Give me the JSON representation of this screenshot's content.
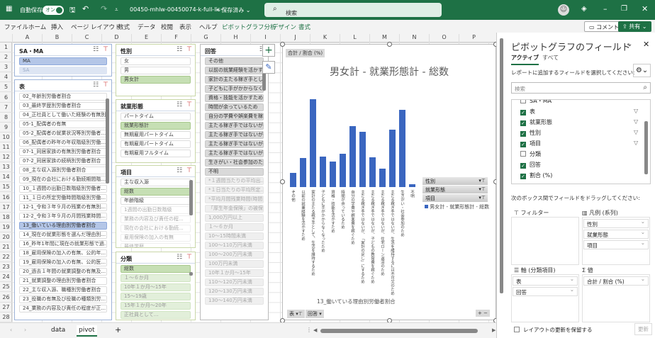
{
  "titlebar": {
    "autosave_label": "自動保存",
    "autosave_state": "オン",
    "filename": "00450-mhlw-00450074-k-full-lis···",
    "save_status": "• 保存済み ⌄",
    "search_placeholder": "検索"
  },
  "ribbon": {
    "tabs": [
      "ファイル",
      "ホーム",
      "挿入",
      "ページ レイアウト",
      "数式",
      "データ",
      "校閲",
      "表示",
      "ヘルプ",
      "ピボットグラフ分析",
      "デザイン",
      "書式"
    ],
    "comment_label": "コメント",
    "share_label": "共有"
  },
  "columns": [
    "A",
    "B",
    "C",
    "D",
    "E",
    "F",
    "G",
    "H",
    "I",
    "J",
    "K",
    "L",
    "M",
    "N",
    "O",
    "P"
  ],
  "rows": [
    "1",
    "2",
    "3",
    "4",
    "5",
    "6",
    "7",
    "8",
    "9",
    "10",
    "11",
    "12",
    "13",
    "14",
    "15",
    "16",
    "17",
    "18",
    "19",
    "20",
    "21",
    "22",
    "23",
    "24",
    "25",
    "26",
    "27",
    "28"
  ],
  "slicers": {
    "sama": {
      "title": "SA・MA",
      "items": [
        {
          "label": "MA",
          "state": "sel"
        },
        {
          "label": "SA",
          "state": "dim"
        }
      ]
    },
    "hyo": {
      "title": "表",
      "items": [
        {
          "label": "02_年齢別労働者割合",
          "state": ""
        },
        {
          "label": "03_最終学歴別労働者割合",
          "state": ""
        },
        {
          "label": "04_正社員として働いた経験の有無別...",
          "state": ""
        },
        {
          "label": "05-1_配偶者の有無",
          "state": ""
        },
        {
          "label": "05-2_配偶者の就業状況等別労働者...",
          "state": ""
        },
        {
          "label": "06_配偶者の昨年の年収階級別労働...",
          "state": ""
        },
        {
          "label": "07-1_同居家族の有無別労働者割合",
          "state": ""
        },
        {
          "label": "07-2_同居家族の続柄別労働者割合",
          "state": ""
        },
        {
          "label": "08_主な収入源別労働者割合",
          "state": ""
        },
        {
          "label": "09_現在の会社における勤続期間階...",
          "state": ""
        },
        {
          "label": "10_１週間の出勤日数階級別労働者...",
          "state": ""
        },
        {
          "label": "11_１日の所定労働時間階級別労働...",
          "state": ""
        },
        {
          "label": "12-1_令和３年９月の残業の有無別...",
          "state": ""
        },
        {
          "label": "12-2_令和３年９月の月間残業時間...",
          "state": ""
        },
        {
          "label": "13_働いている理由別労働者割合",
          "state": "sel"
        },
        {
          "label": "14_現在の就業形態を選んだ理由別...",
          "state": ""
        },
        {
          "label": "16_昨年1年間に現在の就業形態で過...",
          "state": ""
        },
        {
          "label": "18_雇用保険の加入の有無、公的年...",
          "state": ""
        },
        {
          "label": "19_雇用保険の加入の有無、公的医...",
          "state": ""
        },
        {
          "label": "20_過去１年間の就業調整の有無及...",
          "state": ""
        },
        {
          "label": "21_就業調整の理由別労働者割合",
          "state": ""
        },
        {
          "label": "22_主な収入源、職種別労働者割合",
          "state": ""
        },
        {
          "label": "23_役職の有無及び役職の種類別労...",
          "state": ""
        },
        {
          "label": "24_業務の内容及び責任の程度が正...",
          "state": ""
        }
      ]
    },
    "seibetsu": {
      "title": "性別",
      "items": [
        {
          "label": "女",
          "state": ""
        },
        {
          "label": "男",
          "state": ""
        },
        {
          "label": "男女計",
          "state": "sel"
        }
      ]
    },
    "shugyo": {
      "title": "就業形態",
      "items": [
        {
          "label": "パートタイム",
          "state": ""
        },
        {
          "label": "就業形態計",
          "state": "sel"
        },
        {
          "label": "無期雇用パートタイム",
          "state": ""
        },
        {
          "label": "有期雇用パートタイム",
          "state": ""
        },
        {
          "label": "有期雇用フルタイム",
          "state": ""
        }
      ]
    },
    "komoku": {
      "title": "項目",
      "items": [
        {
          "label": "主な収入源",
          "state": ""
        },
        {
          "label": "総数",
          "state": "sel"
        },
        {
          "label": "年齢階級",
          "state": ""
        },
        {
          "label": "1週間の出勤日数階級",
          "state": "nodata"
        },
        {
          "label": "業務の内容及び責任の程...",
          "state": "nodata"
        },
        {
          "label": "現在の会社における勤続...",
          "state": "nodata"
        },
        {
          "label": "雇用保険の加入の有無",
          "state": "nodata"
        },
        {
          "label": "最終学歴",
          "state": "nodata"
        }
      ]
    },
    "bunrui": {
      "title": "分類",
      "items": [
        {
          "label": "総数",
          "state": "sel"
        },
        {
          "label": "１～６か月",
          "state": "dimsel"
        },
        {
          "label": "10年１か月～15年",
          "state": "dimsel"
        },
        {
          "label": "15～19歳",
          "state": "dimsel"
        },
        {
          "label": "15年１か月～20年",
          "state": "dimsel"
        },
        {
          "label": "正社員として...",
          "state": "dimsel"
        }
      ]
    },
    "kaito": {
      "title": "回答",
      "items": [
        {
          "label": "その他",
          "state": ""
        },
        {
          "label": "以前の就業経験を活かす...",
          "state": ""
        },
        {
          "label": "家計の主たる稼ぎ手とし...",
          "state": ""
        },
        {
          "label": "子どもに手がかからなく...",
          "state": ""
        },
        {
          "label": "資格・技能を活かすため",
          "state": ""
        },
        {
          "label": "時間が余っているため",
          "state": ""
        },
        {
          "label": "自分の学費や娯楽費を稼...",
          "state": ""
        },
        {
          "label": "主たる稼ぎ手ではないが...",
          "state": ""
        },
        {
          "label": "主たる稼ぎ手ではないが...",
          "state": ""
        },
        {
          "label": "主たる稼ぎ手ではないが...",
          "state": ""
        },
        {
          "label": "主たる稼ぎ手ではないが...",
          "state": ""
        },
        {
          "label": "生きがい・社会参加のため",
          "state": ""
        },
        {
          "label": "不明",
          "state": ""
        },
        {
          "label": "*１週間当たりの平均出...",
          "state": "nodata"
        },
        {
          "label": "*１日当たりの平均所定...",
          "state": "nodata"
        },
        {
          "label": "*平均月間残業時間(時間)",
          "state": "nodata"
        },
        {
          "label": "「厚生年金保険」の被保...",
          "state": "nodata"
        },
        {
          "label": "1,000万円以上",
          "state": "nodata"
        },
        {
          "label": "１～６か月",
          "state": "nodata"
        },
        {
          "label": "10～15時間未満",
          "state": "nodata"
        },
        {
          "label": "100～110万円未満",
          "state": "nodata"
        },
        {
          "label": "100～200万円未満",
          "state": "nodata"
        },
        {
          "label": "100万円未満",
          "state": "nodata"
        },
        {
          "label": "10年１か月～15年",
          "state": "nodata"
        },
        {
          "label": "110～120万円未満",
          "state": "nodata"
        },
        {
          "label": "120～130万円未満",
          "state": "nodata"
        },
        {
          "label": "130～140万円未満",
          "state": "nodata"
        }
      ]
    }
  },
  "chart_data": {
    "type": "bar",
    "title": "男女計 - 就業形態計 - 総数",
    "value_field_button": "合計 / 割合 (%)",
    "xlabel": "13_働いている理由別労働者割合",
    "ylabel": "",
    "grid": true,
    "legend_position": "right",
    "legend_field_buttons": [
      "性別",
      "就業形態",
      "項目"
    ],
    "axis_field_buttons": [
      "表",
      "回答"
    ],
    "categories": [
      "その他",
      "以前の就業経験を活かすため",
      "家計の主たる稼ぎ手として、生活を維持するため",
      "子どもに手がかからなくなったため",
      "資格・技能を活かすため",
      "時間が余っているため",
      "自分の学費や娯楽費を稼ぐため",
      "主たる稼ぎ手ではないが、「家計の足し」にするため",
      "主たる稼ぎ手ではないが、子どもの教育費を稼ぐため",
      "主たる稼ぎ手ではないが、住宅ローン返済のため",
      "主たる稼ぎ手ではないが、生活を維持するには不可欠のため",
      "生きがい・社会参加のため",
      "不明"
    ],
    "series": [
      {
        "name": "男女計 - 就業形態計 - 総数",
        "color": "#3a66c0",
        "values": [
          3.2,
          6.5,
          19.7,
          6.8,
          5.7,
          7.5,
          13.7,
          12.4,
          6.7,
          4.1,
          12.9,
          17.3,
          0.6
        ]
      }
    ],
    "ylim": [
      0,
      22
    ]
  },
  "panel": {
    "title": "ピボットグラフのフィールド",
    "tabs": [
      "アクティブ",
      "すべて"
    ],
    "instruction": "レポートに追加するフィールドを選択してください:",
    "search_placeholder": "検索",
    "fields": [
      {
        "label": "SA・MA",
        "checked": false,
        "filter": false
      },
      {
        "label": "表",
        "checked": true,
        "filter": true
      },
      {
        "label": "就業形態",
        "checked": true,
        "filter": true
      },
      {
        "label": "性別",
        "checked": true,
        "filter": true
      },
      {
        "label": "項目",
        "checked": true,
        "filter": true
      },
      {
        "label": "分類",
        "checked": false,
        "filter": false
      },
      {
        "label": "回答",
        "checked": true,
        "filter": false
      },
      {
        "label": "割合 (%)",
        "checked": true,
        "filter": false
      }
    ],
    "drag_instruction": "次のボックス間でフィールドをドラッグしてください:",
    "areas": {
      "filter": {
        "title": "フィルター",
        "items": []
      },
      "legend": {
        "title": "凡例 (系列)",
        "items": [
          "性別",
          "就業形態",
          "項目"
        ]
      },
      "axis": {
        "title": "軸 (分類項目)",
        "items": [
          "表",
          "回答"
        ]
      },
      "values": {
        "title": "値",
        "items": [
          "合計 / 割合 (%)"
        ]
      }
    },
    "defer_label": "レイアウトの更新を保留する",
    "update_label": "更新"
  },
  "sheets": {
    "tabs": [
      "data",
      "pivot"
    ],
    "active": "pivot"
  }
}
